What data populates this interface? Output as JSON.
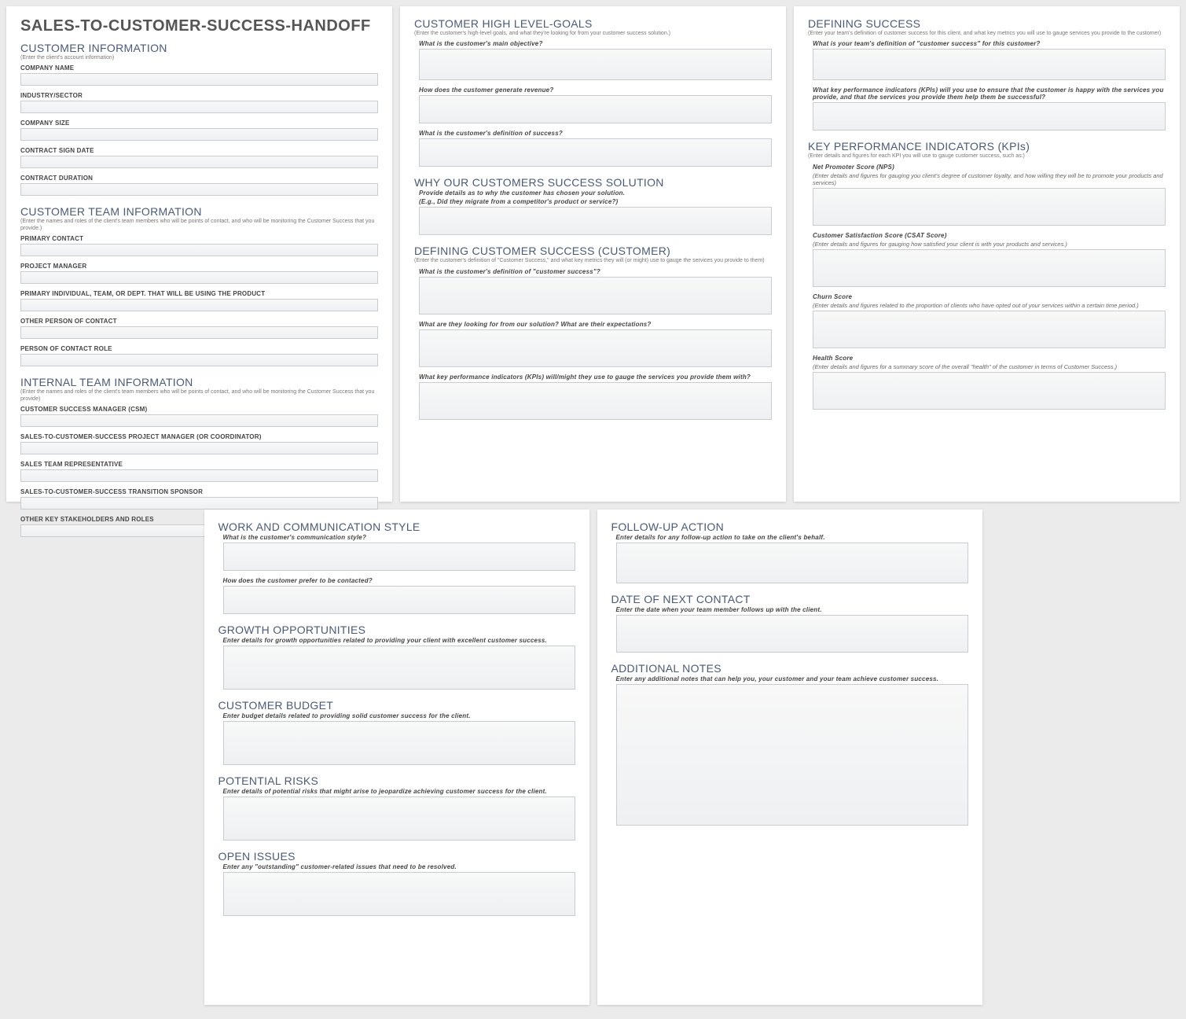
{
  "doc_title": "SALES-TO-CUSTOMER-SUCCESS-HANDOFF",
  "card1": {
    "customer_info": {
      "title": "CUSTOMER INFORMATION",
      "desc": "(Enter the client's account information)",
      "company_name": "COMPANY NAME",
      "industry": "INDUSTRY/SECTOR",
      "size": "COMPANY SIZE",
      "sign_date": "CONTRACT SIGN DATE",
      "duration": "CONTRACT DURATION"
    },
    "customer_team": {
      "title": "CUSTOMER TEAM INFORMATION",
      "desc": "(Enter the names and roles of the client's team members who will be points of contact, and who will be monitoring the Customer Success that you provide.)",
      "primary_contact": "PRIMARY CONTACT",
      "project_manager": "PROJECT MANAGER",
      "primary_user": "PRIMARY INDIVIDUAL, TEAM, OR DEPT. THAT WILL BE USING THE PRODUCT",
      "other_contact": "OTHER PERSON OF CONTACT",
      "contact_role": "PERSON OF CONTACT ROLE"
    },
    "internal_team": {
      "title": "INTERNAL TEAM INFORMATION",
      "desc": "(Enter the names and roles of the client's team members who will be points of contact, and who will be monitoring the Customer Success that you provide)",
      "csm": "CUSTOMER SUCCESS MANAGER (CSM)",
      "pm": "SALES-TO-CUSTOMER-SUCCESS PROJECT MANAGER (OR COORDINATOR)",
      "sales_rep": "SALES TEAM REPRESENTATIVE",
      "sponsor": "SALES-TO-CUSTOMER-SUCCESS TRANSITION SPONSOR",
      "other": "OTHER KEY STAKEHOLDERS AND ROLES"
    }
  },
  "card2": {
    "goals": {
      "title": "CUSTOMER HIGH LEVEL-GOALS",
      "desc": "(Enter the customer's high-level goals, and what they're looking for from your customer success solution.)",
      "q1": "What is the customer's main objective?",
      "q2": "How does the customer generate revenue?",
      "q3": "What is the customer's definition of success?"
    },
    "why": {
      "title": "WHY OUR CUSTOMERS SUCCESS SOLUTION",
      "q1a": "Provide details as to why the customer has chosen your solution.",
      "q1b": "(E.g., Did they migrate from a competitor's product or service?)"
    },
    "defining_cust": {
      "title": "DEFINING CUSTOMER SUCCESS (CUSTOMER)",
      "desc": "(Enter the customer's definition of \"Customer Success,\" and what key metrics they will (or might) use to gauge the services you provide to them)",
      "q1": "What is the customer's definition of \"customer success\"?",
      "q2": "What are they looking for from our solution? What are their expectations?",
      "q3": "What key performance indicators (KPIs) will/might they use to gauge the services you provide them with?"
    }
  },
  "card3": {
    "defining_success": {
      "title": "DEFINING SUCCESS",
      "desc": "(Enter your team's definition of customer success for this client, and what key metrics you will use to gauge services you provide to the customer)",
      "q1": "What is your team's definition of \"customer success\" for this customer?",
      "q2": "What key performance indicators (KPIs) will you use to ensure that the customer is happy with the services you provide, and that the services you provide them help them be successful?"
    },
    "kpis": {
      "title": "KEY PERFORMANCE INDICATORS (KPIs)",
      "desc": "(Enter details and figures for each KPI you will use to gauge customer success, such as:)",
      "nps_label": "Net Promoter Score (NPS)",
      "nps_desc": "(Enter details and figures for gauging you client's degree of customer loyalty, and how willing they will be to promote your products and services)",
      "csat_label": "Customer Satisfaction Score (CSAT Score)",
      "csat_desc": "(Enter details and figures for gauging how satisfied your client is with your products and services.)",
      "churn_label": "Churn Score",
      "churn_desc": "(Enter details and figures related to the proportion of clients who have opted out of your services within a certain time period.)",
      "health_label": "Health Score",
      "health_desc": "(Enter details and figures for a summary score of the overall \"health\" of the customer in terms of Customer Success.)"
    }
  },
  "card4": {
    "comm": {
      "title": "WORK AND COMMUNICATION STYLE",
      "q1": "What is the customer's communication style?",
      "q2": "How does the customer prefer to be contacted?"
    },
    "growth": {
      "title": "GROWTH OPPORTUNITIES",
      "q1": "Enter details for growth opportunities related to providing your client with excellent customer success."
    },
    "budget": {
      "title": "CUSTOMER BUDGET",
      "q1": "Enter budget details related to providing solid customer success for the client."
    },
    "risks": {
      "title": "POTENTIAL RISKS",
      "q1": "Enter details of potential risks that might arise to jeopardize achieving customer success for the client."
    },
    "issues": {
      "title": "OPEN ISSUES",
      "q1": "Enter any \"outstanding\" customer-related issues that need to be resolved."
    }
  },
  "card5": {
    "followup": {
      "title": "FOLLOW-UP ACTION",
      "q1": "Enter details for any follow-up action to take on the client's behalf."
    },
    "next": {
      "title": "DATE OF NEXT CONTACT",
      "q1": "Enter the date when your team member follows up with the client."
    },
    "notes": {
      "title": "ADDITIONAL NOTES",
      "q1": "Enter any additional notes that can help you, your customer and your team achieve customer success."
    }
  }
}
